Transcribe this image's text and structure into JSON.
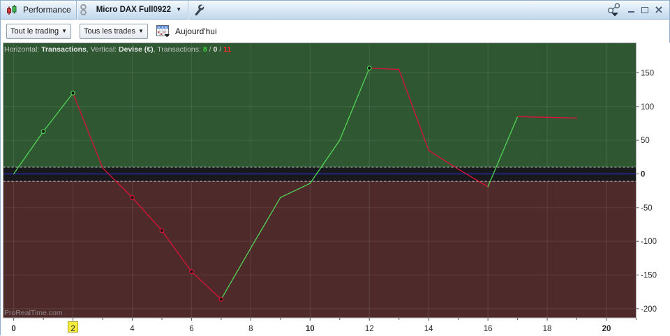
{
  "titlebar": {
    "tab": "Performance",
    "instrument": "Micro DAX Full0922"
  },
  "toolbar": {
    "scope": "Tout le trading",
    "trades": "Tous les trades",
    "date": "Aujourd'hui"
  },
  "icons": {
    "caret": "▼",
    "minimize": "–",
    "maximize": "□",
    "close": "×"
  },
  "chart_header": {
    "h_label": "Horizontal: ",
    "h_value": "Transactions",
    "comma": ", ",
    "v_label": "Vertical: ",
    "v_value": "Devise (€)",
    "t_label": "Transactions: ",
    "wins": "8",
    "slash": " / ",
    "breakeven": "0",
    "losses": "11"
  },
  "watermark": "ProRealTime.com",
  "chart_data": {
    "type": "line",
    "title": "",
    "xlabel": "Transactions",
    "ylabel": "Devise (€)",
    "x": [
      0,
      1,
      2,
      3,
      4,
      5,
      6,
      7,
      8,
      9,
      10,
      11,
      12,
      13,
      14,
      15,
      16,
      17,
      18,
      19
    ],
    "values": [
      0,
      63,
      120,
      9,
      -35,
      -84,
      -145,
      -186,
      -110,
      -35,
      -14,
      50,
      157,
      155,
      35,
      7,
      -19,
      85,
      84,
      83
    ],
    "segment_results": [
      "win",
      "win",
      "loss",
      "loss",
      "loss",
      "loss",
      "loss",
      "win",
      "win",
      "win",
      "win",
      "win",
      "loss",
      "loss",
      "loss",
      "loss",
      "win",
      "loss",
      "loss"
    ],
    "markers": [
      {
        "x": 1,
        "result": "win"
      },
      {
        "x": 2,
        "result": "win"
      },
      {
        "x": 4,
        "result": "loss"
      },
      {
        "x": 5,
        "result": "loss"
      },
      {
        "x": 6,
        "result": "loss"
      },
      {
        "x": 7,
        "result": "loss"
      },
      {
        "x": 12,
        "result": "win"
      }
    ],
    "x_ticks": [
      0,
      2,
      4,
      6,
      8,
      10,
      12,
      14,
      16,
      18,
      20
    ],
    "x_bold": [
      0,
      10,
      20
    ],
    "x_highlight": 2,
    "x_minor_step": 1,
    "xlim": [
      0,
      21
    ],
    "y_ticks": [
      150,
      100,
      50,
      0,
      -50,
      -100,
      -150,
      -200
    ],
    "y_bold": [
      0
    ],
    "ylim": [
      -213,
      194
    ],
    "zero_level": 0,
    "dashed_levels": [
      10,
      -11
    ],
    "band": [
      10,
      -11
    ],
    "grid": true,
    "legend_position": "none",
    "colors": {
      "positive_bg": "#2f5732",
      "negative_bg": "#4e2b2a",
      "zero_band": "#17191c",
      "zero_line": "#2d2dc8",
      "dashed_line_pos": "#cbdfc7",
      "dashed_line_neg": "#dfc9c9",
      "grid": "rgba(255,255,255,0.10)",
      "win_line": "#52d457",
      "loss_line": "#dc1238",
      "marker_fill": "#121712",
      "axis_text": "#1a1a1a",
      "highlight_bg": "#f6ec3d",
      "highlight_border": "#a9a023"
    }
  }
}
